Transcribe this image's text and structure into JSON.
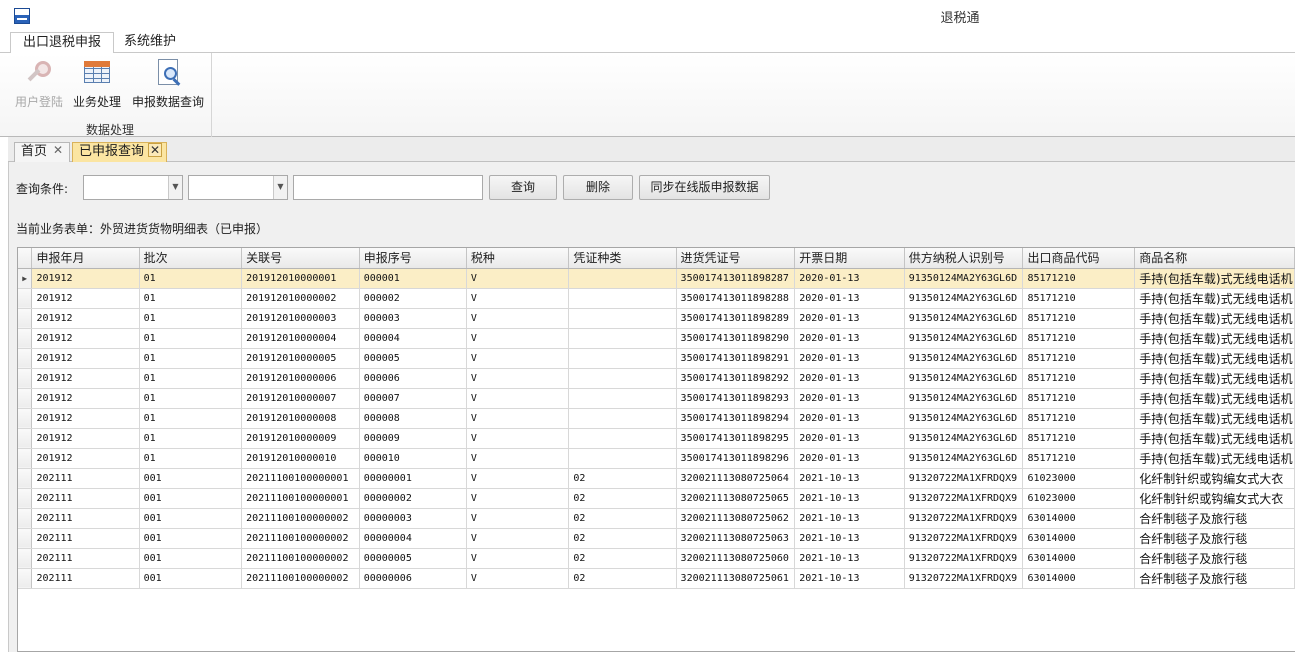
{
  "window": {
    "title": "退税通"
  },
  "ribbon_tabs": [
    {
      "label": "出口退税申报"
    },
    {
      "label": "系统维护"
    }
  ],
  "ribbon": {
    "buttons": [
      {
        "label": "用户登陆",
        "icon": "key-icon",
        "enabled": false
      },
      {
        "label": "业务处理",
        "icon": "spreadsheet-icon",
        "enabled": true
      },
      {
        "label": "申报数据查询",
        "icon": "document-search-icon",
        "enabled": true
      }
    ],
    "group_label": "数据处理"
  },
  "doc_tabs": [
    {
      "label": "首页",
      "close": "✕"
    },
    {
      "label": "已申报查询",
      "close": "✕"
    }
  ],
  "query": {
    "label": "查询条件:",
    "combo1_value": "",
    "combo2_value": "",
    "text_value": "",
    "query_button": "查询",
    "delete_button": "删除",
    "sync_button": "同步在线版申报数据"
  },
  "form_label": "当前业务表单：外贸进货货物明细表（已申报）",
  "table": {
    "columns": [
      "申报年月",
      "批次",
      "关联号",
      "申报序号",
      "税种",
      "凭证种类",
      "进货凭证号",
      "开票日期",
      "供方纳税人识别号",
      "出口商品代码",
      "商品名称"
    ],
    "rows": [
      [
        "201912",
        "01",
        "201912010000001",
        "000001",
        "V",
        "",
        "350017413011898287",
        "2020-01-13",
        "91350124MA2Y63GL6D",
        "85171210",
        "手持(包括车载)式无线电话机"
      ],
      [
        "201912",
        "01",
        "201912010000002",
        "000002",
        "V",
        "",
        "350017413011898288",
        "2020-01-13",
        "91350124MA2Y63GL6D",
        "85171210",
        "手持(包括车载)式无线电话机"
      ],
      [
        "201912",
        "01",
        "201912010000003",
        "000003",
        "V",
        "",
        "350017413011898289",
        "2020-01-13",
        "91350124MA2Y63GL6D",
        "85171210",
        "手持(包括车载)式无线电话机"
      ],
      [
        "201912",
        "01",
        "201912010000004",
        "000004",
        "V",
        "",
        "350017413011898290",
        "2020-01-13",
        "91350124MA2Y63GL6D",
        "85171210",
        "手持(包括车载)式无线电话机"
      ],
      [
        "201912",
        "01",
        "201912010000005",
        "000005",
        "V",
        "",
        "350017413011898291",
        "2020-01-13",
        "91350124MA2Y63GL6D",
        "85171210",
        "手持(包括车载)式无线电话机"
      ],
      [
        "201912",
        "01",
        "201912010000006",
        "000006",
        "V",
        "",
        "350017413011898292",
        "2020-01-13",
        "91350124MA2Y63GL6D",
        "85171210",
        "手持(包括车载)式无线电话机"
      ],
      [
        "201912",
        "01",
        "201912010000007",
        "000007",
        "V",
        "",
        "350017413011898293",
        "2020-01-13",
        "91350124MA2Y63GL6D",
        "85171210",
        "手持(包括车载)式无线电话机"
      ],
      [
        "201912",
        "01",
        "201912010000008",
        "000008",
        "V",
        "",
        "350017413011898294",
        "2020-01-13",
        "91350124MA2Y63GL6D",
        "85171210",
        "手持(包括车载)式无线电话机"
      ],
      [
        "201912",
        "01",
        "201912010000009",
        "000009",
        "V",
        "",
        "350017413011898295",
        "2020-01-13",
        "91350124MA2Y63GL6D",
        "85171210",
        "手持(包括车载)式无线电话机"
      ],
      [
        "201912",
        "01",
        "201912010000010",
        "000010",
        "V",
        "",
        "350017413011898296",
        "2020-01-13",
        "91350124MA2Y63GL6D",
        "85171210",
        "手持(包括车载)式无线电话机"
      ],
      [
        "202111",
        "001",
        "20211100100000001",
        "00000001",
        "V",
        "02",
        "320021113080725064",
        "2021-10-13",
        "91320722MA1XFRDQX9",
        "61023000",
        "化纤制针织或钩编女式大衣"
      ],
      [
        "202111",
        "001",
        "20211100100000001",
        "00000002",
        "V",
        "02",
        "320021113080725065",
        "2021-10-13",
        "91320722MA1XFRDQX9",
        "61023000",
        "化纤制针织或钩编女式大衣"
      ],
      [
        "202111",
        "001",
        "20211100100000002",
        "00000003",
        "V",
        "02",
        "320021113080725062",
        "2021-10-13",
        "91320722MA1XFRDQX9",
        "63014000",
        "合纤制毯子及旅行毯"
      ],
      [
        "202111",
        "001",
        "20211100100000002",
        "00000004",
        "V",
        "02",
        "320021113080725063",
        "2021-10-13",
        "91320722MA1XFRDQX9",
        "63014000",
        "合纤制毯子及旅行毯"
      ],
      [
        "202111",
        "001",
        "20211100100000002",
        "00000005",
        "V",
        "02",
        "320021113080725060",
        "2021-10-13",
        "91320722MA1XFRDQX9",
        "63014000",
        "合纤制毯子及旅行毯"
      ],
      [
        "202111",
        "001",
        "20211100100000002",
        "00000006",
        "V",
        "02",
        "320021113080725061",
        "2021-10-13",
        "91320722MA1XFRDQX9",
        "63014000",
        "合纤制毯子及旅行毯"
      ]
    ],
    "selected_row": 0,
    "current_row_marker": "▶"
  },
  "colors": {
    "selected_row": "#fbeec6",
    "active_tab": "#fbe5a2"
  }
}
